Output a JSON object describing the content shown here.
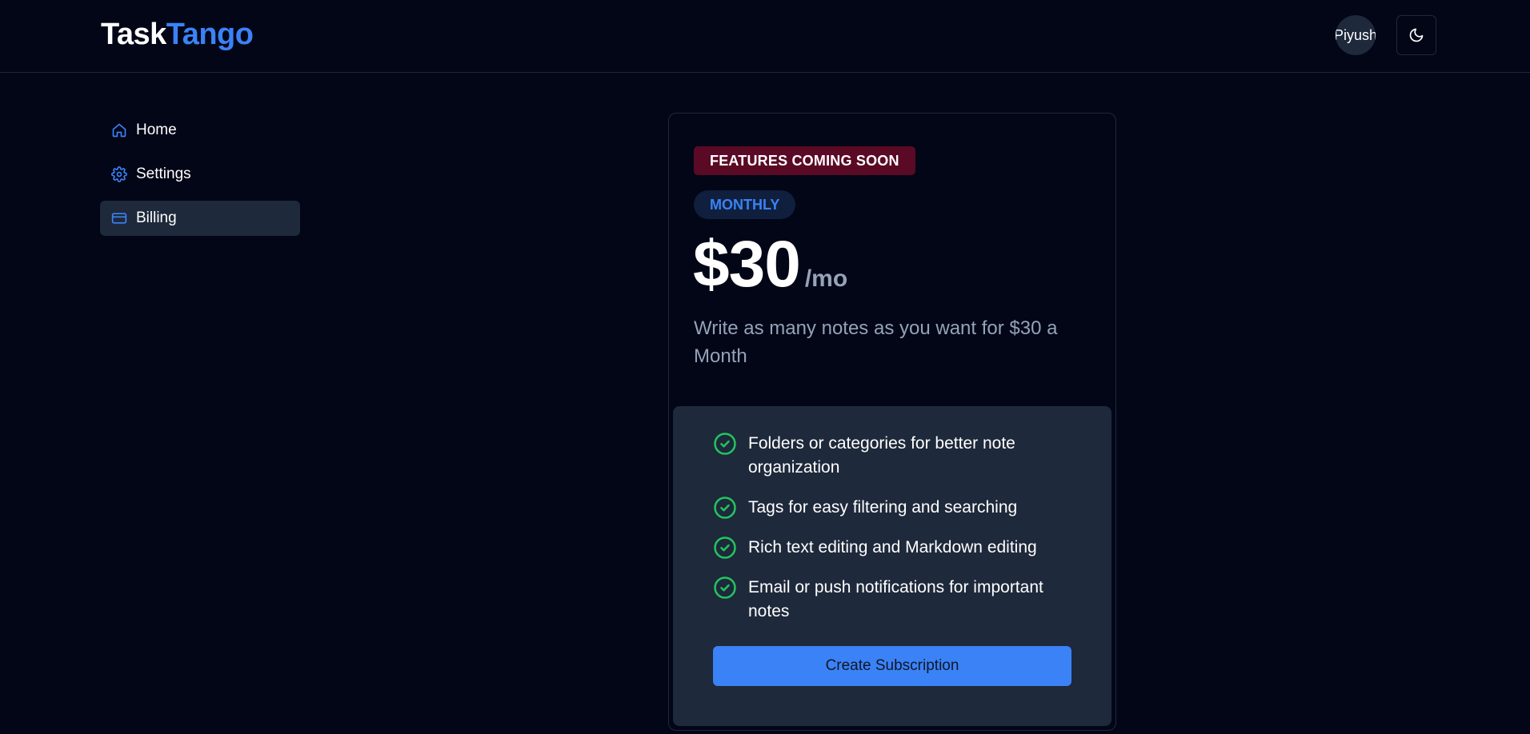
{
  "header": {
    "logo_part1": "Task",
    "logo_part2": "Tango",
    "avatar_text": "Piyush",
    "theme_toggle_icon": "moon-icon"
  },
  "sidebar": {
    "items": [
      {
        "label": "Home",
        "icon": "home-icon",
        "active": false
      },
      {
        "label": "Settings",
        "icon": "gear-icon",
        "active": false
      },
      {
        "label": "Billing",
        "icon": "credit-card-icon",
        "active": true
      }
    ]
  },
  "plan": {
    "badge": "FEATURES COMING SOON",
    "interval": "MONTHLY",
    "price": "$30",
    "period": "/mo",
    "description": "Write as many notes as you want for $30 a Month",
    "features": [
      "Folders or categories for better note organization",
      "Tags for easy filtering and searching",
      "Rich text editing and Markdown editing",
      "Email or push notifications for important notes"
    ],
    "cta_label": "Create Subscription"
  },
  "colors": {
    "background": "#020617",
    "accent": "#3b82f6",
    "panel": "#1e293b",
    "badge_soon_bg": "#5a0a24",
    "check": "#22c55e"
  }
}
